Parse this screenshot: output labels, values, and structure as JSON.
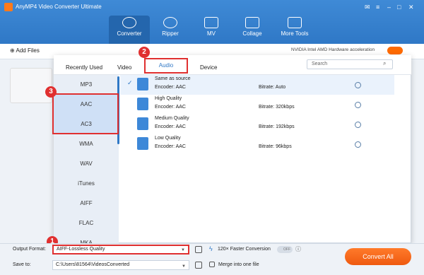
{
  "app": {
    "title": "AnyMP4 Video Converter Ultimate"
  },
  "nav": [
    {
      "label": "Converter",
      "icon": "converter-icon"
    },
    {
      "label": "Ripper",
      "icon": "ripper-icon"
    },
    {
      "label": "MV",
      "icon": "mv-icon"
    },
    {
      "label": "Collage",
      "icon": "collage-icon"
    },
    {
      "label": "More Tools",
      "icon": "toolbox-icon"
    }
  ],
  "toolbar": {
    "add_files": "Add Files",
    "hw_accel": "NVIDIA  Intel  AMD  Hardware acceleration",
    "toggle": "ON"
  },
  "tabs": {
    "recent": "Recently Used",
    "video": "Video",
    "audio": "Audio",
    "device": "Device"
  },
  "search": {
    "placeholder": "Search"
  },
  "formats": [
    "MP3",
    "AAC",
    "AC3",
    "WMA",
    "WAV",
    "iTunes",
    "AIFF",
    "FLAC",
    "MKA"
  ],
  "presets": [
    {
      "name": "Same as source",
      "encoder": "Encoder: AAC",
      "bitrate": "Bitrate: Auto"
    },
    {
      "name": "High Quality",
      "encoder": "Encoder: AAC",
      "bitrate": "Bitrate: 320kbps"
    },
    {
      "name": "Medium Quality",
      "encoder": "Encoder: AAC",
      "bitrate": "Bitrate: 192kbps"
    },
    {
      "name": "Low Quality",
      "encoder": "Encoder: AAC",
      "bitrate": "Bitrate: 96kbps"
    }
  ],
  "badges": [
    "1",
    "2",
    "3"
  ],
  "bottom": {
    "output_label": "Output Format:",
    "output_value": "AIFF-Lossless Quality",
    "faster": "120× Faster Conversion",
    "off": "OFF",
    "save_label": "Save to:",
    "save_path": "C:\\Users\\81564\\VideosConverted",
    "merge": "Merge into one file",
    "convert_all": "Convert All"
  },
  "colors": {
    "accent": "#2f78c6",
    "highlight": "#e03030",
    "convert": "#ff6a1a"
  }
}
